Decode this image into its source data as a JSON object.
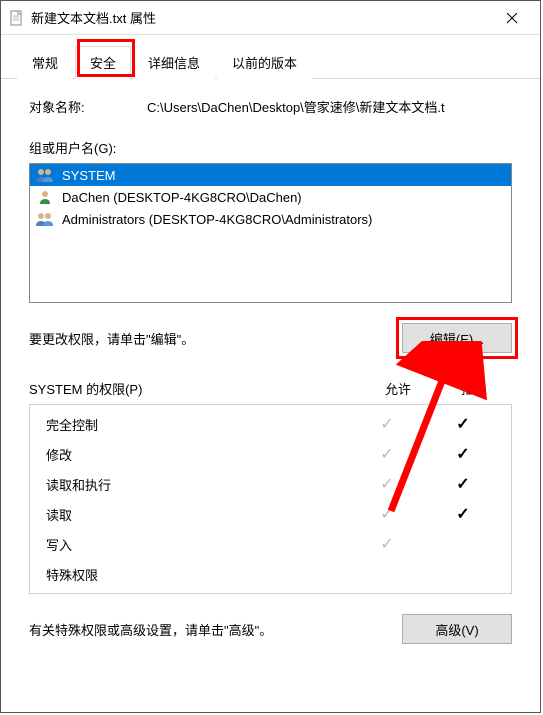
{
  "window": {
    "title": "新建文本文档.txt 属性"
  },
  "tabs": {
    "t0": "常规",
    "t1": "安全",
    "t2": "详细信息",
    "t3": "以前的版本"
  },
  "object": {
    "label": "对象名称:",
    "value": "C:\\Users\\DaChen\\Desktop\\管家速修\\新建文本文档.t"
  },
  "groups": {
    "label": "组或用户名(G):",
    "items": [
      {
        "name": "SYSTEM",
        "icon": "group",
        "selected": true
      },
      {
        "name": "DaChen (DESKTOP-4KG8CRO\\DaChen)",
        "icon": "user",
        "selected": false
      },
      {
        "name": "Administrators (DESKTOP-4KG8CRO\\Administrators)",
        "icon": "group",
        "selected": false
      }
    ]
  },
  "edit": {
    "text": "要更改权限，请单击\"编辑\"。",
    "button": "编辑(E)..."
  },
  "perm": {
    "header": "SYSTEM 的权限(P)",
    "allow": "允许",
    "deny": "拒绝",
    "rows": [
      {
        "name": "完全控制",
        "allow": "gray",
        "deny": "black"
      },
      {
        "name": "修改",
        "allow": "gray",
        "deny": "black"
      },
      {
        "name": "读取和执行",
        "allow": "gray",
        "deny": "black"
      },
      {
        "name": "读取",
        "allow": "gray",
        "deny": "black"
      },
      {
        "name": "写入",
        "allow": "gray",
        "deny": ""
      },
      {
        "name": "特殊权限",
        "allow": "",
        "deny": ""
      }
    ]
  },
  "advanced": {
    "text": "有关特殊权限或高级设置，请单击\"高级\"。",
    "button": "高级(V)"
  }
}
